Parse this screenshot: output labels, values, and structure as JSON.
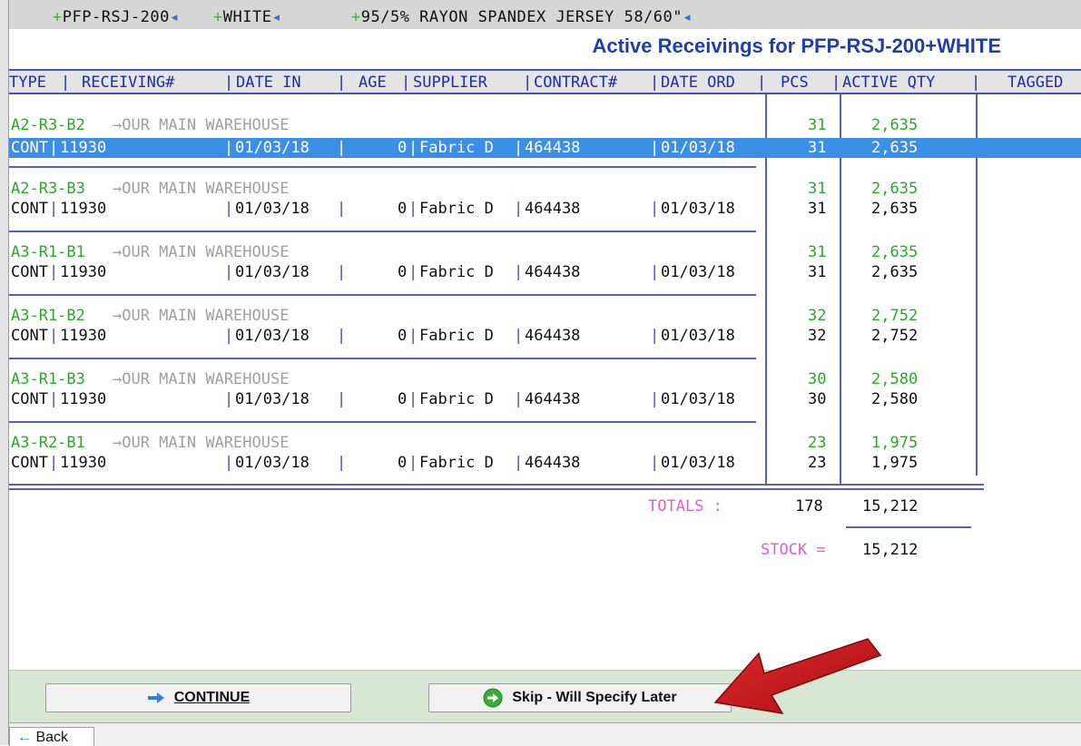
{
  "topbar": {
    "style_code": "PFP-RSJ-200",
    "color": "WHITE",
    "description": "95/5% RAYON SPANDEX JERSEY 58/60\""
  },
  "title": "Active Receivings for PFP-RSJ-200+WHITE",
  "columns": {
    "type": "TYPE",
    "receiving": "RECEIVING#",
    "date_in": "DATE IN",
    "age": "AGE",
    "supplier": "SUPPLIER",
    "contract": "CONTRACT#",
    "date_ord": "DATE ORD",
    "pcs": "PCS",
    "active_qty": "ACTIVE QTY",
    "tagged": "TAGGED"
  },
  "groups": [
    {
      "location": "A2-R3-B2",
      "destination": "→OUR MAIN WAREHOUSE",
      "sum_pcs": "31",
      "sum_qty": "2,635",
      "row": {
        "type": "CONT",
        "receiving": "11930",
        "date_in": "01/03/18",
        "age": "0",
        "supplier": "Fabric D",
        "contract": "464438",
        "date_ord": "01/03/18",
        "pcs": "31",
        "qty": "2,635"
      }
    },
    {
      "location": "A2-R3-B3",
      "destination": "→OUR MAIN WAREHOUSE",
      "sum_pcs": "31",
      "sum_qty": "2,635",
      "row": {
        "type": "CONT",
        "receiving": "11930",
        "date_in": "01/03/18",
        "age": "0",
        "supplier": "Fabric D",
        "contract": "464438",
        "date_ord": "01/03/18",
        "pcs": "31",
        "qty": "2,635"
      }
    },
    {
      "location": "A3-R1-B1",
      "destination": "→OUR MAIN WAREHOUSE",
      "sum_pcs": "31",
      "sum_qty": "2,635",
      "row": {
        "type": "CONT",
        "receiving": "11930",
        "date_in": "01/03/18",
        "age": "0",
        "supplier": "Fabric D",
        "contract": "464438",
        "date_ord": "01/03/18",
        "pcs": "31",
        "qty": "2,635"
      }
    },
    {
      "location": "A3-R1-B2",
      "destination": "→OUR MAIN WAREHOUSE",
      "sum_pcs": "32",
      "sum_qty": "2,752",
      "row": {
        "type": "CONT",
        "receiving": "11930",
        "date_in": "01/03/18",
        "age": "0",
        "supplier": "Fabric D",
        "contract": "464438",
        "date_ord": "01/03/18",
        "pcs": "32",
        "qty": "2,752"
      }
    },
    {
      "location": "A3-R1-B3",
      "destination": "→OUR MAIN WAREHOUSE",
      "sum_pcs": "30",
      "sum_qty": "2,580",
      "row": {
        "type": "CONT",
        "receiving": "11930",
        "date_in": "01/03/18",
        "age": "0",
        "supplier": "Fabric D",
        "contract": "464438",
        "date_ord": "01/03/18",
        "pcs": "30",
        "qty": "2,580"
      }
    },
    {
      "location": "A3-R2-B1",
      "destination": "→OUR MAIN WAREHOUSE",
      "sum_pcs": "23",
      "sum_qty": "1,975",
      "row": {
        "type": "CONT",
        "receiving": "11930",
        "date_in": "01/03/18",
        "age": "0",
        "supplier": "Fabric D",
        "contract": "464438",
        "date_ord": "01/03/18",
        "pcs": "23",
        "qty": "1,975"
      }
    }
  ],
  "totals": {
    "label": "TOTALS :",
    "pcs": "178",
    "qty": "15,212",
    "stock_label": "STOCK =",
    "stock_qty": "15,212"
  },
  "buttons": {
    "continue_label": "CONTINUE",
    "skip_label": "Skip - Will Specify Later"
  },
  "bottom_tab": {
    "label": "Back"
  },
  "colors": {
    "title": "#1f40a8",
    "selected_row": "#3c8fe6",
    "location_green": "#2aa82a",
    "totals_pink": "#e160c8",
    "footer_bg": "#d8e6d2",
    "annotation_arrow": "#c8191e"
  },
  "icons": {
    "continue": "arrow-right-icon",
    "skip": "green-circle-arrow-icon",
    "annotation": "red-pointer-arrow"
  }
}
